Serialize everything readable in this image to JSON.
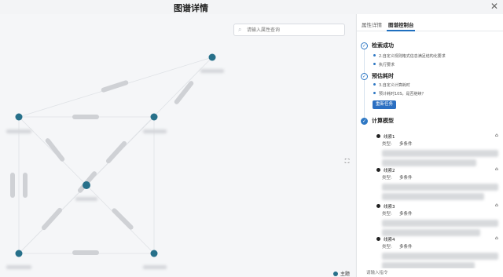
{
  "window": {
    "title": "图谱详情",
    "close_glyph": "✕"
  },
  "canvas": {
    "search": {
      "placeholder": "请输入属性查询"
    },
    "fit_glyph": "⛶",
    "legend": {
      "label": "主题",
      "color": "#27708a"
    },
    "node_color": "#27708a",
    "edge_label_color": "#c9cbcf"
  },
  "panel": {
    "tabs": [
      {
        "label": "属性详情",
        "active": false
      },
      {
        "label": "图谱控制台",
        "active": true
      }
    ],
    "steps": [
      {
        "title": "检索成功",
        "bullets": [
          "2.自定义规则格式信息满足结构化要求",
          "执行要求"
        ]
      },
      {
        "title": "预估耗时",
        "bullets": [
          "3.自定义计算耗时",
          "预计耗时10S，是否继续？"
        ],
        "button": "重新任务"
      },
      {
        "title": "计算模型",
        "bullets": []
      }
    ],
    "clues": [
      {
        "name": "线索1",
        "type_label": "类型:",
        "type_value": "多条件"
      },
      {
        "name": "线索2",
        "type_label": "类型:",
        "type_value": "多条件"
      },
      {
        "name": "线索3",
        "type_label": "类型:",
        "type_value": "多条件"
      },
      {
        "name": "线索4",
        "type_label": "类型:",
        "type_value": "多条件"
      }
    ],
    "chat_placeholder": "请输入指令"
  },
  "colors": {
    "accent": "#2f78c4",
    "node": "#27708a",
    "tab_underline": "#1f6fbf"
  }
}
